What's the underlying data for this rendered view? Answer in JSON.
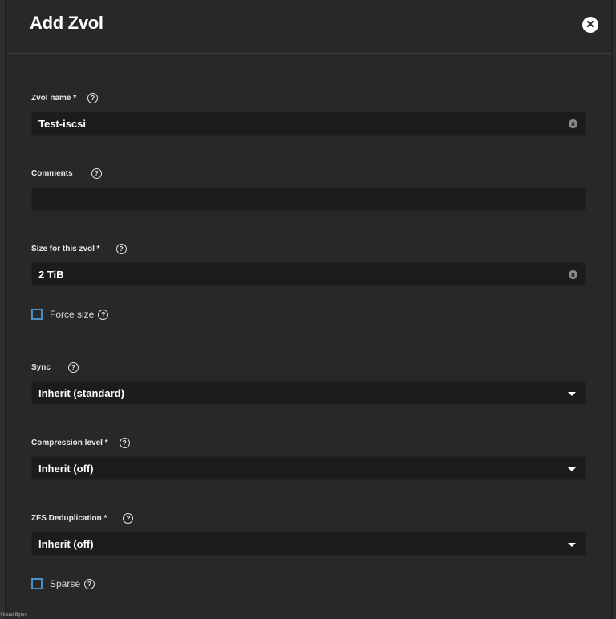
{
  "dialog": {
    "title": "Add Zvol"
  },
  "fields": {
    "zvol_name": {
      "label": "Zvol name *",
      "value": "Test-iscsi"
    },
    "comments": {
      "label": "Comments",
      "value": ""
    },
    "size": {
      "label": "Size for this zvol *",
      "value": "2 TiB"
    },
    "force_size": {
      "label": "Force size",
      "checked": false
    },
    "sync": {
      "label": "Sync",
      "value": "Inherit (standard)"
    },
    "compression": {
      "label": "Compression level *",
      "value": "Inherit (off)"
    },
    "dedup": {
      "label": "ZFS Deduplication *",
      "value": "Inherit (off)"
    },
    "sparse": {
      "label": "Sparse",
      "checked": false
    }
  },
  "footer": {
    "text": "Virtual Bytes"
  },
  "icons": {
    "help": "question-circle-icon",
    "clear": "clear-circle-icon",
    "close": "close-circle-icon",
    "dropdown": "caret-down-icon"
  },
  "colors": {
    "background": "#282828",
    "field_background": "#1c1c1c",
    "checkbox_border": "#4a90c6",
    "text": "#ffffff"
  }
}
